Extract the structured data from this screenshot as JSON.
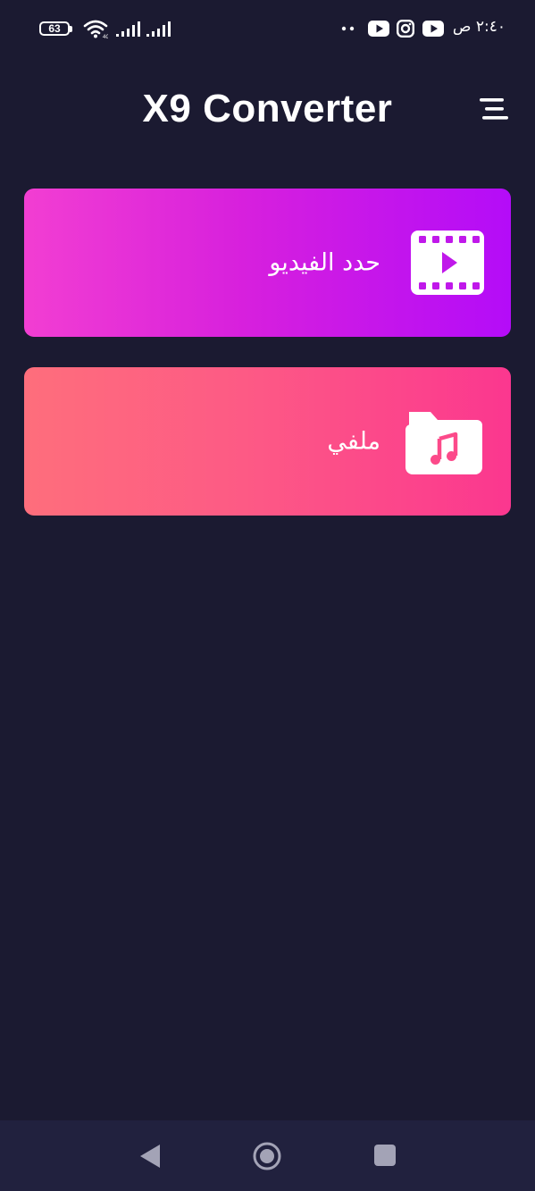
{
  "status_bar": {
    "battery_level": "63",
    "clock": "٢:٤٠ ص",
    "icons": [
      "battery-icon",
      "wifi-icon",
      "signal-icon",
      "signal-icon",
      "more-notifications-icon",
      "youtube-icon",
      "instagram-icon",
      "youtube-icon"
    ]
  },
  "header": {
    "title": "X9 Converter",
    "menu_icon": "menu-icon"
  },
  "cards": [
    {
      "label": "حدد الفيديو",
      "icon": "video-film-icon",
      "gradient": [
        "#f23ed2",
        "#b40cf8"
      ]
    },
    {
      "label": "ملفي",
      "icon": "music-folder-icon",
      "gradient": [
        "#fe6e7c",
        "#fb378f"
      ]
    }
  ],
  "nav_bar": {
    "icons": [
      "back-icon",
      "home-icon",
      "recents-icon"
    ]
  },
  "colors": {
    "background": "#1b1a31",
    "nav_background": "#21213e",
    "text": "#ffffff"
  }
}
